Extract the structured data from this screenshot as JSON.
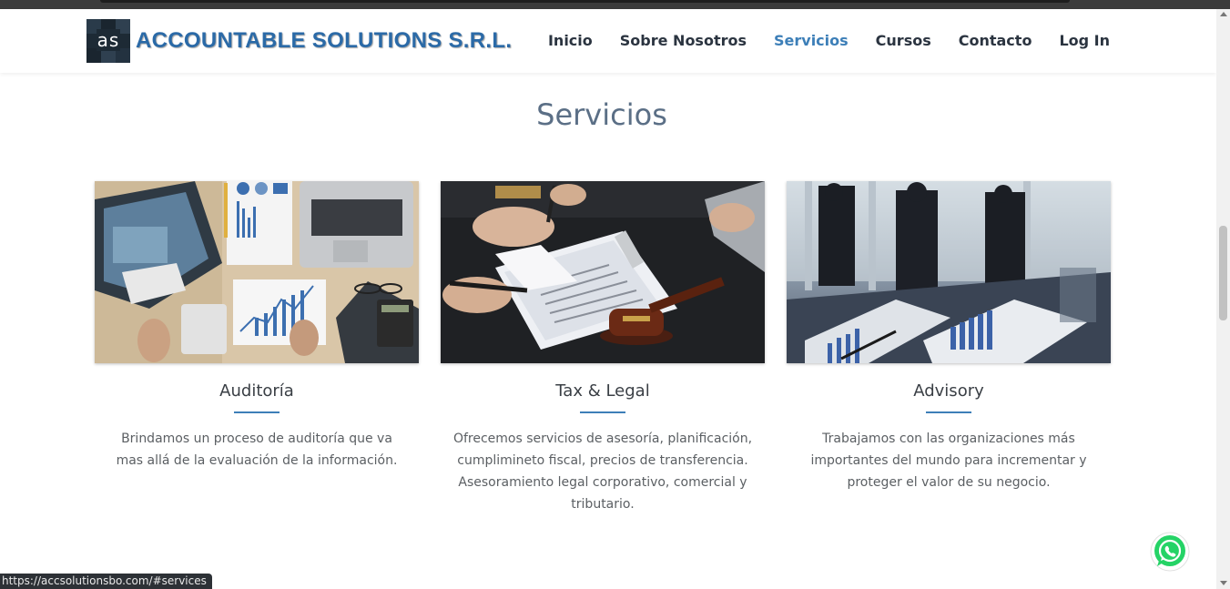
{
  "brand": {
    "logo_text": "as",
    "name": "ACCOUNTABLE SOLUTIONS S.R.L."
  },
  "nav": {
    "items": [
      {
        "label": "Inicio",
        "active": false
      },
      {
        "label": "Sobre Nosotros",
        "active": false
      },
      {
        "label": "Servicios",
        "active": true
      },
      {
        "label": "Cursos",
        "active": false
      },
      {
        "label": "Contacto",
        "active": false
      },
      {
        "label": "Log In",
        "active": false
      }
    ]
  },
  "section": {
    "title": "Servicios"
  },
  "services": [
    {
      "title": "Auditoría",
      "description": "Brindamos un proceso de auditoría que va mas allá de la evaluación de la información.",
      "image": "analytics-charts-desk-photo"
    },
    {
      "title": "Tax & Legal",
      "description": "Ofrecemos servicios de asesoría, planificación, cumplimineto fiscal, precios de transferencia. Asesoramiento legal corporativo, comercial y tributario.",
      "image": "legal-document-gavel-photo"
    },
    {
      "title": "Advisory",
      "description": "Trabajamos con las organizaciones más importantes del mundo para incrementar y proteger el valor de su negocio.",
      "image": "business-people-meeting-photo"
    }
  ],
  "status_bar": {
    "url": "https://accsolutionsbo.com/#services"
  },
  "colors": {
    "accent": "#3d7fb8",
    "brand": "#2b6aa7",
    "title": "#5b6f86",
    "whatsapp": "#25d366"
  }
}
